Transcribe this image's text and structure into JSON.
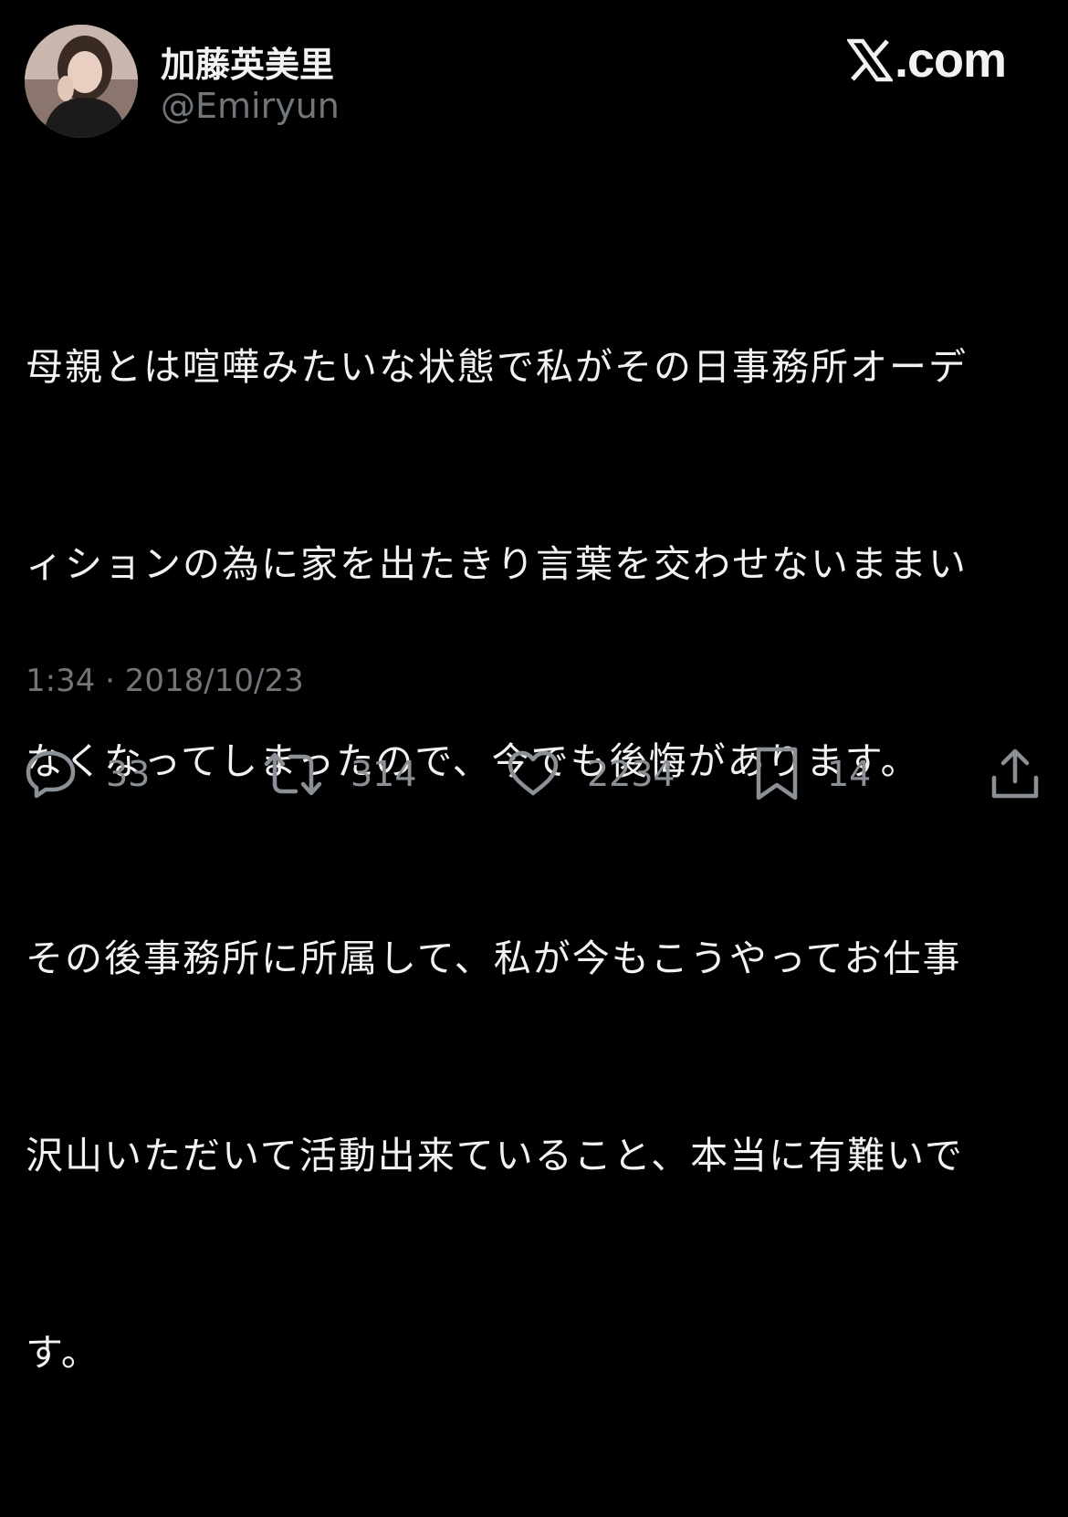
{
  "author": {
    "display_name": "加藤英美里",
    "handle": "@Emiryun"
  },
  "brand": {
    "text": ".com"
  },
  "tweet": {
    "lines": [
      "母親とは喧嘩みたいな状態で私がその日事務所オーデ",
      "ィションの為に家を出たきり言葉を交わせないままい",
      "なくなってしまったので、今でも後悔があります。",
      "その後事務所に所属して、私が今もこうやってお仕事",
      "沢山いただいて活動出来ていること、本当に有難いで",
      "す。"
    ],
    "timestamp": "1:34 · 2018/10/23"
  },
  "actions": {
    "reply_count": "33",
    "retweet_count": "314",
    "like_count": "2234",
    "bookmark_count": "14"
  }
}
